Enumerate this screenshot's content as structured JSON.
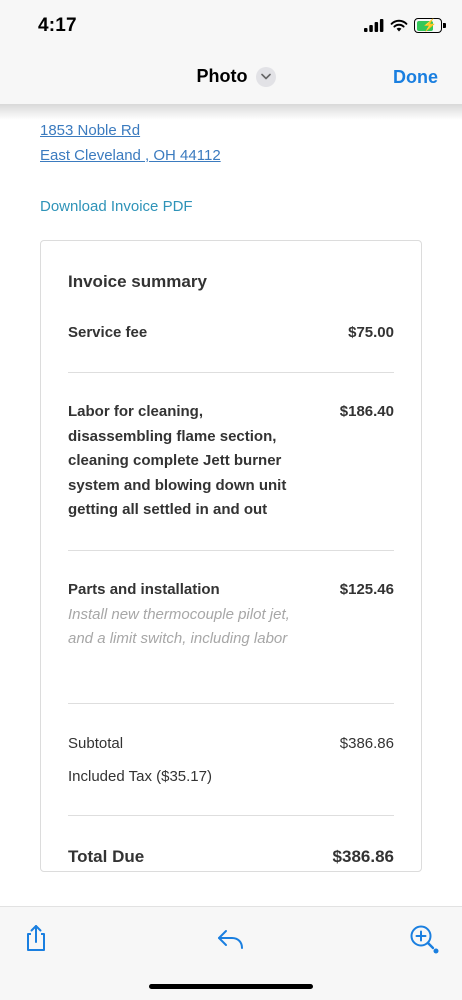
{
  "status": {
    "time": "4:17",
    "battery_level": 0.75
  },
  "nav": {
    "title": "Photo",
    "done_label": "Done"
  },
  "content": {
    "address_line1": "1853 Noble Rd",
    "address_line2": "East Cleveland , OH 44112",
    "download_label": "Download Invoice PDF"
  },
  "invoice": {
    "title": "Invoice summary",
    "items": [
      {
        "label": "Service fee",
        "amount": "$75.00",
        "description": ""
      },
      {
        "label": "Labor for cleaning, disassembling flame section, cleaning complete Jett burner system and blowing down unit getting all settled in and out",
        "amount": "$186.40",
        "description": ""
      },
      {
        "label": "Parts and installation",
        "amount": "$125.46",
        "description": "Install new thermocouple pilot jet, and a limit switch, including labor"
      }
    ],
    "subtotal_label": "Subtotal",
    "subtotal_amount": "$386.86",
    "tax_label": "Included Tax ($35.17)",
    "total_label": "Total Due",
    "total_amount": "$386.86"
  },
  "colors": {
    "accent": "#1a7fe0",
    "link": "#3b7bbf",
    "download_link": "#2e93b8",
    "battery": "#34c759"
  },
  "toolbar": {
    "icons": [
      "share-icon",
      "reply-icon",
      "markup-zoom-icon"
    ]
  }
}
